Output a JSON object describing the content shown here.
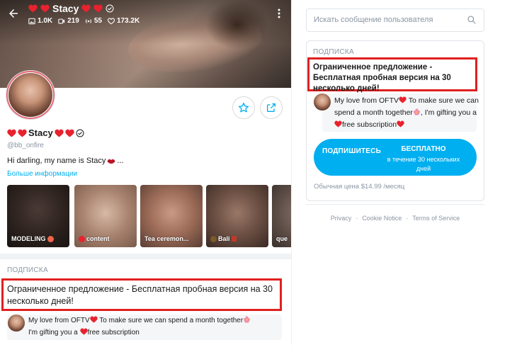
{
  "cover": {
    "name": "Stacy",
    "stats": {
      "photos": "1.0K",
      "videos": "219",
      "streams": "55",
      "likes": "173.2K"
    }
  },
  "profile": {
    "name": "Stacy",
    "username": "@bb_onfire",
    "bio": "Hi darling, my name is Stacy",
    "bio_suffix": "...",
    "more_info": "Больше информации"
  },
  "stories": [
    {
      "label": "MODELING",
      "emoji": "smiley-emoji"
    },
    {
      "label": "content",
      "emoji": "heart-emoji"
    },
    {
      "label": "Tea ceremon...",
      "emoji": ""
    },
    {
      "label": "Bali",
      "emoji": "torii-emoji"
    },
    {
      "label": "que",
      "emoji": ""
    }
  ],
  "subscription_left": {
    "label": "ПОДПИСКА",
    "offer": "Ограниченное предложение - Бесплатная пробная версия на 30 несколько дней!",
    "message_part1": "My love from OFTV",
    "message_part2": " To make sure we can spend a month together",
    "message_part3": "I'm gifting you a ",
    "message_part4": "free subscription"
  },
  "search": {
    "placeholder": "Искать сообщение пользователя"
  },
  "subscription_right": {
    "label": "ПОДПИСКА",
    "offer": "Ограниченное предложение - Бесплатная пробная версия на 30 несколько дней!",
    "message_part1": "My love from OFTV",
    "message_part2": " To make sure we can spend a month together",
    "message_part3": ", I'm gifting you a ",
    "message_part4": "free subscription",
    "cta_left": "ПОДПИШИТЕСЬ",
    "cta_right_1": "БЕСПЛАТНО",
    "cta_right_2": "в течение 30 нескольких дней",
    "price": "Обычная цена $14.99 /месяц"
  },
  "footer": {
    "privacy": "Privacy",
    "cookie": "Cookie Notice",
    "terms": "Terms of Service"
  },
  "colors": {
    "accent": "#00aff0",
    "highlight_border": "#e0201f",
    "muted": "#8a96a3"
  }
}
